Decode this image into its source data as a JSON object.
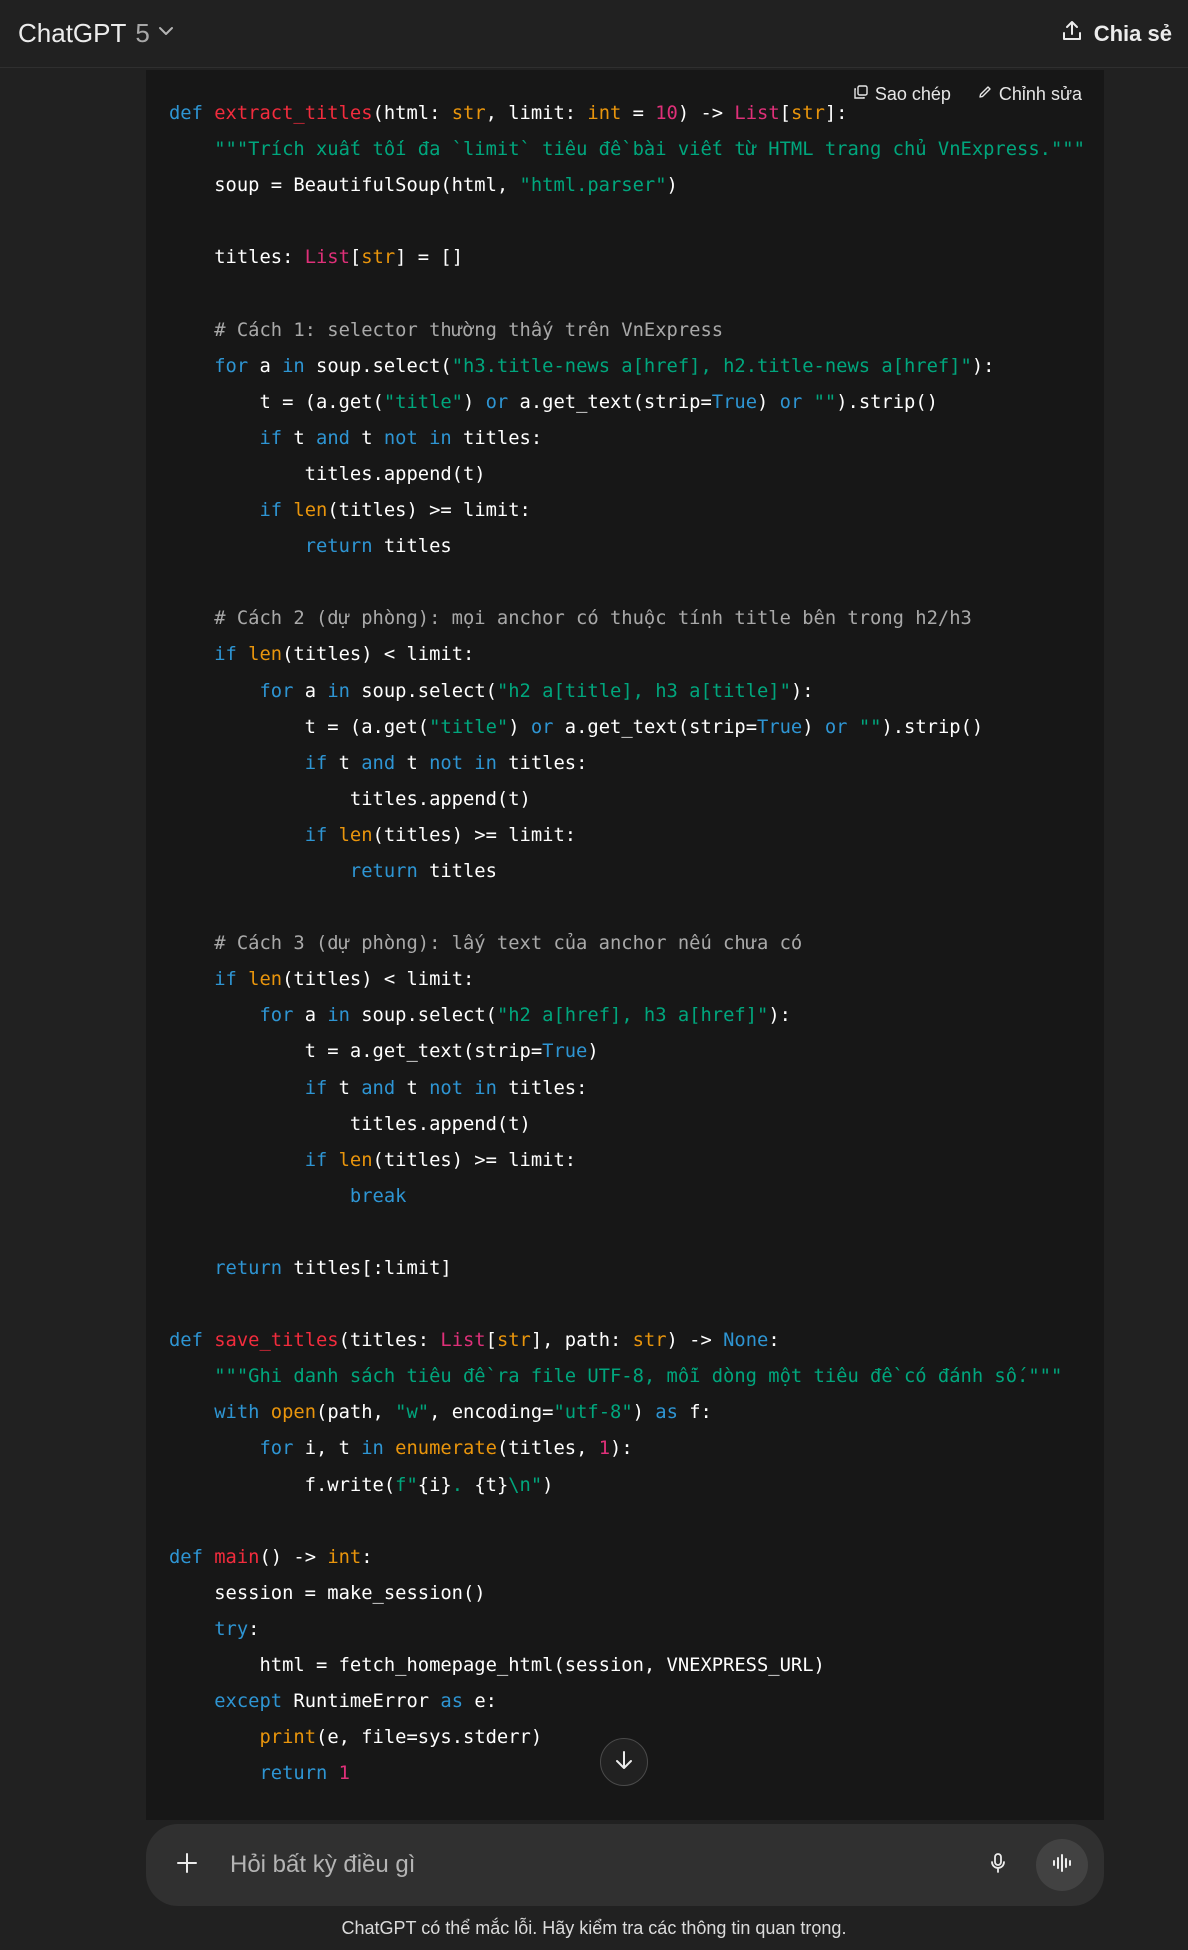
{
  "header": {
    "model_name": "ChatGPT",
    "model_version": "5",
    "share_label": "Chia sẻ"
  },
  "code_block": {
    "copy_label": "Sao chép",
    "edit_label": "Chỉnh sửa",
    "lines": [
      [
        [
          "kw",
          "def "
        ],
        [
          "fn",
          "extract_titles"
        ],
        [
          "p",
          "(html: "
        ],
        [
          "bi",
          "str"
        ],
        [
          "p",
          ", limit: "
        ],
        [
          "bi",
          "int"
        ],
        [
          "p",
          " = "
        ],
        [
          "num",
          "10"
        ],
        [
          "p",
          ") -> "
        ],
        [
          "type",
          "List"
        ],
        [
          "p",
          "["
        ],
        [
          "bi",
          "str"
        ],
        [
          "p",
          "]:"
        ]
      ],
      [
        [
          "p",
          "    "
        ],
        [
          "str",
          "\"\"\"Trích xuất tối đa `limit` tiêu đề bài viết từ HTML trang chủ VnExpress.\"\"\""
        ]
      ],
      [
        [
          "p",
          "    soup = BeautifulSoup(html, "
        ],
        [
          "str",
          "\"html.parser\""
        ],
        [
          "p",
          ")"
        ]
      ],
      [],
      [
        [
          "p",
          "    titles: "
        ],
        [
          "type",
          "List"
        ],
        [
          "p",
          "["
        ],
        [
          "bi",
          "str"
        ],
        [
          "p",
          "] = []"
        ]
      ],
      [],
      [
        [
          "com",
          "    # Cách 1: selector thường thấy trên VnExpress"
        ]
      ],
      [
        [
          "p",
          "    "
        ],
        [
          "kw",
          "for"
        ],
        [
          "p",
          " a "
        ],
        [
          "kw",
          "in"
        ],
        [
          "p",
          " soup.select("
        ],
        [
          "str",
          "\"h3.title-news a[href], h2.title-news a[href]\""
        ],
        [
          "p",
          "):"
        ]
      ],
      [
        [
          "p",
          "        t = (a.get("
        ],
        [
          "str",
          "\"title\""
        ],
        [
          "p",
          ") "
        ],
        [
          "kw",
          "or"
        ],
        [
          "p",
          " a.get_text(strip="
        ],
        [
          "kw",
          "True"
        ],
        [
          "p",
          ") "
        ],
        [
          "kw",
          "or"
        ],
        [
          "p",
          " "
        ],
        [
          "str",
          "\"\""
        ],
        [
          "p",
          ").strip()"
        ]
      ],
      [
        [
          "p",
          "        "
        ],
        [
          "kw",
          "if"
        ],
        [
          "p",
          " t "
        ],
        [
          "kw",
          "and"
        ],
        [
          "p",
          " t "
        ],
        [
          "kw",
          "not in"
        ],
        [
          "p",
          " titles:"
        ]
      ],
      [
        [
          "p",
          "            titles.append(t)"
        ]
      ],
      [
        [
          "p",
          "        "
        ],
        [
          "kw",
          "if"
        ],
        [
          "p",
          " "
        ],
        [
          "bi",
          "len"
        ],
        [
          "p",
          "(titles) >= limit:"
        ]
      ],
      [
        [
          "p",
          "            "
        ],
        [
          "kw",
          "return"
        ],
        [
          "p",
          " titles"
        ]
      ],
      [],
      [
        [
          "com",
          "    # Cách 2 (dự phòng): mọi anchor có thuộc tính title bên trong h2/h3"
        ]
      ],
      [
        [
          "p",
          "    "
        ],
        [
          "kw",
          "if"
        ],
        [
          "p",
          " "
        ],
        [
          "bi",
          "len"
        ],
        [
          "p",
          "(titles) < limit:"
        ]
      ],
      [
        [
          "p",
          "        "
        ],
        [
          "kw",
          "for"
        ],
        [
          "p",
          " a "
        ],
        [
          "kw",
          "in"
        ],
        [
          "p",
          " soup.select("
        ],
        [
          "str",
          "\"h2 a[title], h3 a[title]\""
        ],
        [
          "p",
          "):"
        ]
      ],
      [
        [
          "p",
          "            t = (a.get("
        ],
        [
          "str",
          "\"title\""
        ],
        [
          "p",
          ") "
        ],
        [
          "kw",
          "or"
        ],
        [
          "p",
          " a.get_text(strip="
        ],
        [
          "kw",
          "True"
        ],
        [
          "p",
          ") "
        ],
        [
          "kw",
          "or"
        ],
        [
          "p",
          " "
        ],
        [
          "str",
          "\"\""
        ],
        [
          "p",
          ").strip()"
        ]
      ],
      [
        [
          "p",
          "            "
        ],
        [
          "kw",
          "if"
        ],
        [
          "p",
          " t "
        ],
        [
          "kw",
          "and"
        ],
        [
          "p",
          " t "
        ],
        [
          "kw",
          "not in"
        ],
        [
          "p",
          " titles:"
        ]
      ],
      [
        [
          "p",
          "                titles.append(t)"
        ]
      ],
      [
        [
          "p",
          "            "
        ],
        [
          "kw",
          "if"
        ],
        [
          "p",
          " "
        ],
        [
          "bi",
          "len"
        ],
        [
          "p",
          "(titles) >= limit:"
        ]
      ],
      [
        [
          "p",
          "                "
        ],
        [
          "kw",
          "return"
        ],
        [
          "p",
          " titles"
        ]
      ],
      [],
      [
        [
          "com",
          "    # Cách 3 (dự phòng): lấy text của anchor nếu chưa có"
        ]
      ],
      [
        [
          "p",
          "    "
        ],
        [
          "kw",
          "if"
        ],
        [
          "p",
          " "
        ],
        [
          "bi",
          "len"
        ],
        [
          "p",
          "(titles) < limit:"
        ]
      ],
      [
        [
          "p",
          "        "
        ],
        [
          "kw",
          "for"
        ],
        [
          "p",
          " a "
        ],
        [
          "kw",
          "in"
        ],
        [
          "p",
          " soup.select("
        ],
        [
          "str",
          "\"h2 a[href], h3 a[href]\""
        ],
        [
          "p",
          "):"
        ]
      ],
      [
        [
          "p",
          "            t = a.get_text(strip="
        ],
        [
          "kw",
          "True"
        ],
        [
          "p",
          ")"
        ]
      ],
      [
        [
          "p",
          "            "
        ],
        [
          "kw",
          "if"
        ],
        [
          "p",
          " t "
        ],
        [
          "kw",
          "and"
        ],
        [
          "p",
          " t "
        ],
        [
          "kw",
          "not in"
        ],
        [
          "p",
          " titles:"
        ]
      ],
      [
        [
          "p",
          "                titles.append(t)"
        ]
      ],
      [
        [
          "p",
          "            "
        ],
        [
          "kw",
          "if"
        ],
        [
          "p",
          " "
        ],
        [
          "bi",
          "len"
        ],
        [
          "p",
          "(titles) >= limit:"
        ]
      ],
      [
        [
          "p",
          "                "
        ],
        [
          "kw",
          "break"
        ]
      ],
      [],
      [
        [
          "p",
          "    "
        ],
        [
          "kw",
          "return"
        ],
        [
          "p",
          " titles[:limit]"
        ]
      ],
      [],
      [
        [
          "kw",
          "def "
        ],
        [
          "fn",
          "save_titles"
        ],
        [
          "p",
          "(titles: "
        ],
        [
          "type",
          "List"
        ],
        [
          "p",
          "["
        ],
        [
          "bi",
          "str"
        ],
        [
          "p",
          "], path: "
        ],
        [
          "bi",
          "str"
        ],
        [
          "p",
          ") -> "
        ],
        [
          "kw",
          "None"
        ],
        [
          "p",
          ":"
        ]
      ],
      [
        [
          "p",
          "    "
        ],
        [
          "str",
          "\"\"\"Ghi danh sách tiêu đề ra file UTF-8, mỗi dòng một tiêu đề có đánh số.\"\"\""
        ]
      ],
      [
        [
          "p",
          "    "
        ],
        [
          "kw",
          "with"
        ],
        [
          "p",
          " "
        ],
        [
          "bi",
          "open"
        ],
        [
          "p",
          "(path, "
        ],
        [
          "str",
          "\"w\""
        ],
        [
          "p",
          ", encoding="
        ],
        [
          "str",
          "\"utf-8\""
        ],
        [
          "p",
          ") "
        ],
        [
          "kw",
          "as"
        ],
        [
          "p",
          " f:"
        ]
      ],
      [
        [
          "p",
          "        "
        ],
        [
          "kw",
          "for"
        ],
        [
          "p",
          " i, t "
        ],
        [
          "kw",
          "in"
        ],
        [
          "p",
          " "
        ],
        [
          "bi",
          "enumerate"
        ],
        [
          "p",
          "(titles, "
        ],
        [
          "num",
          "1"
        ],
        [
          "p",
          "):"
        ]
      ],
      [
        [
          "p",
          "            f.write("
        ],
        [
          "str",
          "f\""
        ],
        [
          "p",
          "{i}"
        ],
        [
          "str",
          ". "
        ],
        [
          "p",
          "{t}"
        ],
        [
          "str",
          "\\n\""
        ],
        [
          "p",
          ")"
        ]
      ],
      [],
      [
        [
          "kw",
          "def "
        ],
        [
          "fn",
          "main"
        ],
        [
          "p",
          "() -> "
        ],
        [
          "bi",
          "int"
        ],
        [
          "p",
          ":"
        ]
      ],
      [
        [
          "p",
          "    session = make_session()"
        ]
      ],
      [
        [
          "p",
          "    "
        ],
        [
          "kw",
          "try"
        ],
        [
          "p",
          ":"
        ]
      ],
      [
        [
          "p",
          "        html = fetch_homepage_html(session, VNEXPRESS_URL)"
        ]
      ],
      [
        [
          "p",
          "    "
        ],
        [
          "kw",
          "except"
        ],
        [
          "p",
          " RuntimeError "
        ],
        [
          "kw",
          "as"
        ],
        [
          "p",
          " e:"
        ]
      ],
      [
        [
          "p",
          "        "
        ],
        [
          "bi",
          "print"
        ],
        [
          "p",
          "(e, file=sys.stderr)"
        ]
      ],
      [
        [
          "p",
          "        "
        ],
        [
          "kw",
          "return"
        ],
        [
          "p",
          " "
        ],
        [
          "num",
          "1"
        ]
      ]
    ]
  },
  "composer": {
    "placeholder": "Hỏi bất kỳ điều gì"
  },
  "footer": {
    "disclaimer": "ChatGPT có thể mắc lỗi. Hãy kiểm tra các thông tin quan trọng."
  }
}
